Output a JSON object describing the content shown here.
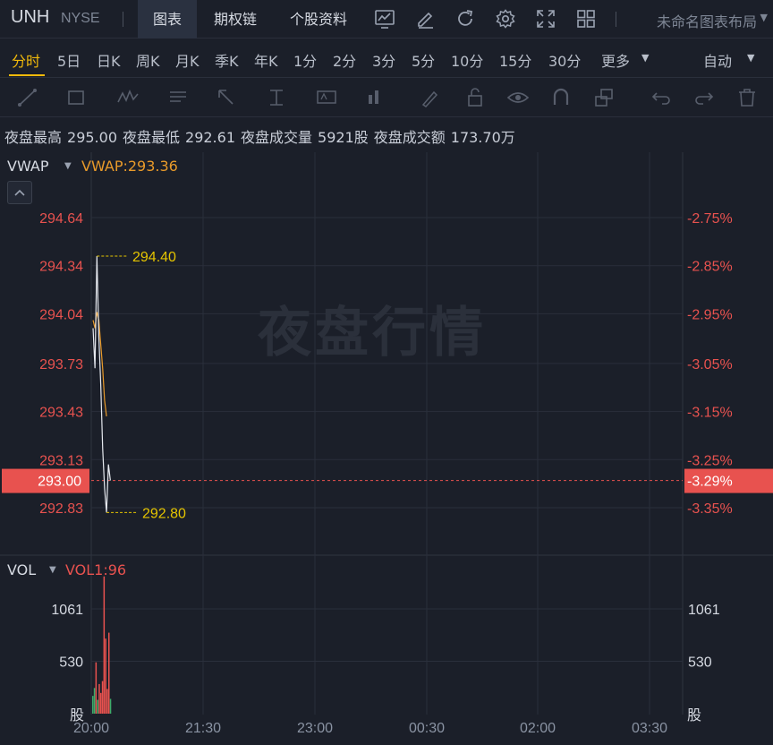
{
  "header": {
    "symbol": "UNH",
    "exchange": "NYSE",
    "tabs": [
      {
        "label": "图表",
        "active": true
      },
      {
        "label": "期权链",
        "active": false
      },
      {
        "label": "个股资料",
        "active": false
      }
    ],
    "icons": [
      "line-chart-icon",
      "pen-edit-icon",
      "refresh-icon",
      "gear-icon",
      "fullscreen-icon",
      "grid-layout-icon"
    ],
    "layout_name": "未命名图表布局"
  },
  "periods": {
    "items": [
      "分时",
      "5日",
      "日K",
      "周K",
      "月K",
      "季K",
      "年K",
      "1分",
      "2分",
      "3分",
      "5分",
      "10分",
      "15分",
      "30分",
      "更多"
    ],
    "active": "分时",
    "scale_mode": "自动"
  },
  "draw_tools": [
    "trend-line-icon",
    "rectangle-icon",
    "wave-pattern-icon",
    "text-note-icon",
    "arrow-icon",
    "price-range-icon",
    "label-box-icon",
    "bar-measure-icon",
    "brush-icon",
    "lock-icon",
    "eye-icon",
    "magnet-icon",
    "clone-icon",
    "undo-icon",
    "redo-icon",
    "trash-icon"
  ],
  "stats": {
    "high_label": "夜盘最高",
    "high_value": "295.00",
    "low_label": "夜盘最低",
    "low_value": "292.61",
    "volume_label": "夜盘成交量",
    "volume_value": "5921股",
    "turnover_label": "夜盘成交额",
    "turnover_value": "173.70万"
  },
  "colors": {
    "background": "#1b1f29",
    "price_up_red": "#e8524f",
    "vwap_orange": "#e89a2a",
    "annot_yellow": "#e5c400",
    "price_line": "#e6e9ef",
    "volume_green": "#3dab6a",
    "grid": "#2a2f3b"
  },
  "chart_data": {
    "type": "line",
    "price_panel": {
      "indicator_name": "VWAP",
      "indicator_value_label": "VWAP:293.36",
      "left_ticks": [
        "294.64",
        "294.34",
        "294.04",
        "293.73",
        "293.43",
        "293.13",
        "292.83"
      ],
      "left_tick_values": [
        294.64,
        294.34,
        294.04,
        293.73,
        293.43,
        293.13,
        292.83
      ],
      "right_ticks": [
        "-2.75%",
        "-2.85%",
        "-2.95%",
        "-3.05%",
        "-3.15%",
        "-3.25%",
        "-3.35%"
      ],
      "current_price": "293.00",
      "current_change": "-3.29%",
      "current_value": 293.0,
      "high_annotation": "294.40",
      "high_value": 294.4,
      "low_annotation": "292.80",
      "low_value": 292.8,
      "watermark": "夜盘行情",
      "price_series": [
        {
          "t": "20:00",
          "v": 293.95
        },
        {
          "t": "20:01",
          "v": 293.7
        },
        {
          "t": "20:02",
          "v": 294.4
        },
        {
          "t": "20:03",
          "v": 293.9
        },
        {
          "t": "20:04",
          "v": 293.6
        },
        {
          "t": "20:05",
          "v": 293.2
        },
        {
          "t": "20:06",
          "v": 292.95
        },
        {
          "t": "20:07",
          "v": 292.8
        },
        {
          "t": "20:08",
          "v": 293.1
        },
        {
          "t": "20:09",
          "v": 293.0
        }
      ],
      "vwap_series": [
        {
          "t": "20:00",
          "v": 294.0
        },
        {
          "t": "20:01",
          "v": 293.95
        },
        {
          "t": "20:02",
          "v": 294.05
        },
        {
          "t": "20:03",
          "v": 294.0
        },
        {
          "t": "20:04",
          "v": 293.85
        },
        {
          "t": "20:05",
          "v": 293.7
        },
        {
          "t": "20:06",
          "v": 293.5
        },
        {
          "t": "20:07",
          "v": 293.4
        }
      ]
    },
    "volume_panel": {
      "indicator_name": "VOL",
      "indicator_value_label": "VOL1:96",
      "ticks": [
        "1061",
        "530"
      ],
      "tick_values": [
        1061,
        530
      ],
      "unit": "股",
      "bars": [
        {
          "t": "20:00",
          "v": 180,
          "color": "green"
        },
        {
          "t": "20:01",
          "v": 260,
          "color": "green"
        },
        {
          "t": "20:02",
          "v": 520,
          "color": "red"
        },
        {
          "t": "20:03",
          "v": 140,
          "color": "green"
        },
        {
          "t": "20:04",
          "v": 300,
          "color": "red"
        },
        {
          "t": "20:05",
          "v": 210,
          "color": "red"
        },
        {
          "t": "20:06",
          "v": 330,
          "color": "red"
        },
        {
          "t": "20:07",
          "v": 1390,
          "color": "red"
        },
        {
          "t": "20:08",
          "v": 760,
          "color": "red"
        },
        {
          "t": "20:09",
          "v": 250,
          "color": "red"
        },
        {
          "t": "20:10",
          "v": 820,
          "color": "red"
        },
        {
          "t": "20:11",
          "v": 150,
          "color": "green"
        }
      ]
    },
    "x_ticks": [
      "20:00",
      "21:30",
      "23:00",
      "00:30",
      "02:00",
      "03:30"
    ]
  }
}
